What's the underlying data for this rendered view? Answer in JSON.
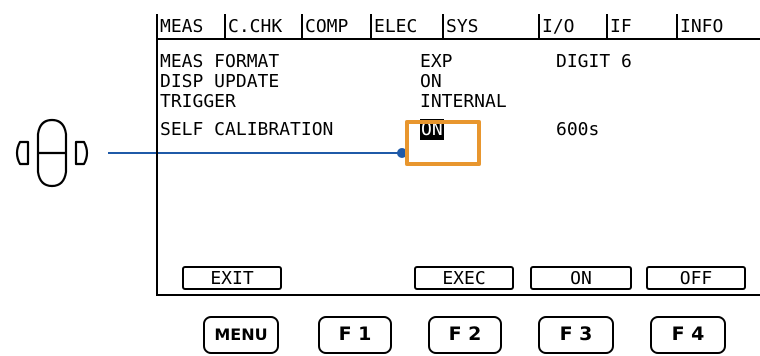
{
  "tabs": [
    "MEAS",
    "C.CHK",
    "COMP",
    "ELEC",
    "SYS",
    "I/O",
    "IF",
    "INFO"
  ],
  "settings": [
    {
      "label": "MEAS FORMAT",
      "value": "EXP",
      "extra": "DIGIT 6"
    },
    {
      "label": "DISP UPDATE",
      "value": "ON",
      "extra": ""
    },
    {
      "label": "TRIGGER",
      "value": "INTERNAL",
      "extra": ""
    },
    {
      "label": "SELF CALIBRATION",
      "value": "ON",
      "extra": "600s"
    }
  ],
  "softkeys": {
    "exit": "EXIT",
    "exec": "EXEC",
    "on": "ON",
    "off": "OFF"
  },
  "hardware_buttons": {
    "menu": "MENU",
    "f1": "F 1",
    "f2": "F 2",
    "f3": "F 3",
    "f4": "F 4"
  },
  "colors": {
    "highlight": "#e8962e",
    "callout": "#1f5aa8"
  },
  "icons": {
    "cursor_keys": "arrow-cursor-keys-icon"
  }
}
